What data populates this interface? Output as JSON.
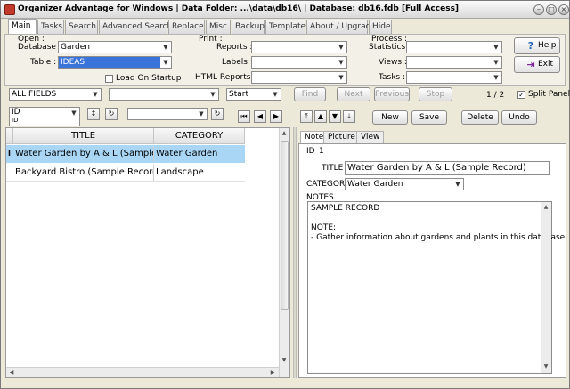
{
  "window": {
    "title": "Organizer Advantage for Windows | Data Folder: ...\\data\\db16\\ | Database: db16.fdb [Full Access]",
    "controls": [
      "minimize-icon",
      "maximize-icon",
      "close-icon"
    ]
  },
  "tabs": [
    "Main",
    "Tasks",
    "Search",
    "Advanced Search",
    "Replace",
    "Misc",
    "Backup",
    "Templates",
    "About / Upgrade",
    "Hide"
  ],
  "open": {
    "section_label": "Open :",
    "database_label": "Database :",
    "database_value": "Garden",
    "table_label": "Table :",
    "table_value": "IDEAS",
    "load_on_startup_label": "Load On Startup"
  },
  "print": {
    "section_label": "Print :",
    "reports_label": "Reports :",
    "labels_label": "Labels :",
    "html_reports_label": "HTML Reports :"
  },
  "process": {
    "section_label": "Process :",
    "statistics_label": "Statistics :",
    "views_label": "Views :",
    "tasks_label": "Tasks :"
  },
  "actions": {
    "help_label": "Help",
    "exit_label": "Exit"
  },
  "search_bar": {
    "field_value": "ALL FIELDS",
    "text_value": "",
    "mode_value": "Start",
    "find_label": "Find",
    "next_label": "Next",
    "previous_label": "Previous",
    "stop_label": "Stop",
    "record_position": "1 / 2",
    "split_panels_label": "Split Panels"
  },
  "sort_bar": {
    "sort_field_value": "ID",
    "sort_field_sub": "ID",
    "filter_value": ""
  },
  "record_bar": {
    "new_label": "New",
    "save_label": "Save",
    "delete_label": "Delete",
    "undo_label": "Undo"
  },
  "grid": {
    "columns": [
      "TITLE",
      "CATEGORY"
    ],
    "rows": [
      {
        "title": "Water Garden by A & L (Sample Record)",
        "category": "Water Garden",
        "selected": true,
        "indicator": "I"
      },
      {
        "title": "Backyard Bistro (Sample Record)",
        "category": "Landscape",
        "selected": false,
        "indicator": ""
      }
    ]
  },
  "detail": {
    "tabs": [
      "Note",
      "Picture",
      "View"
    ],
    "id_label": "ID",
    "id_value": "1",
    "title_label": "TITLE",
    "title_value": "Water Garden by A & L (Sample Record)",
    "category_label": "CATEGORY",
    "category_value": "Water Garden",
    "notes_label": "NOTES",
    "notes_lines": [
      "SAMPLE RECORD",
      "",
      "NOTE:",
      "- Gather information about gardens and plants in this database."
    ]
  },
  "colors": {
    "selection": "#3a73d9",
    "row_highlight": "#a9d6f5",
    "help_icon": "#1f5fbf",
    "exit_icon": "#7a2a9a"
  }
}
